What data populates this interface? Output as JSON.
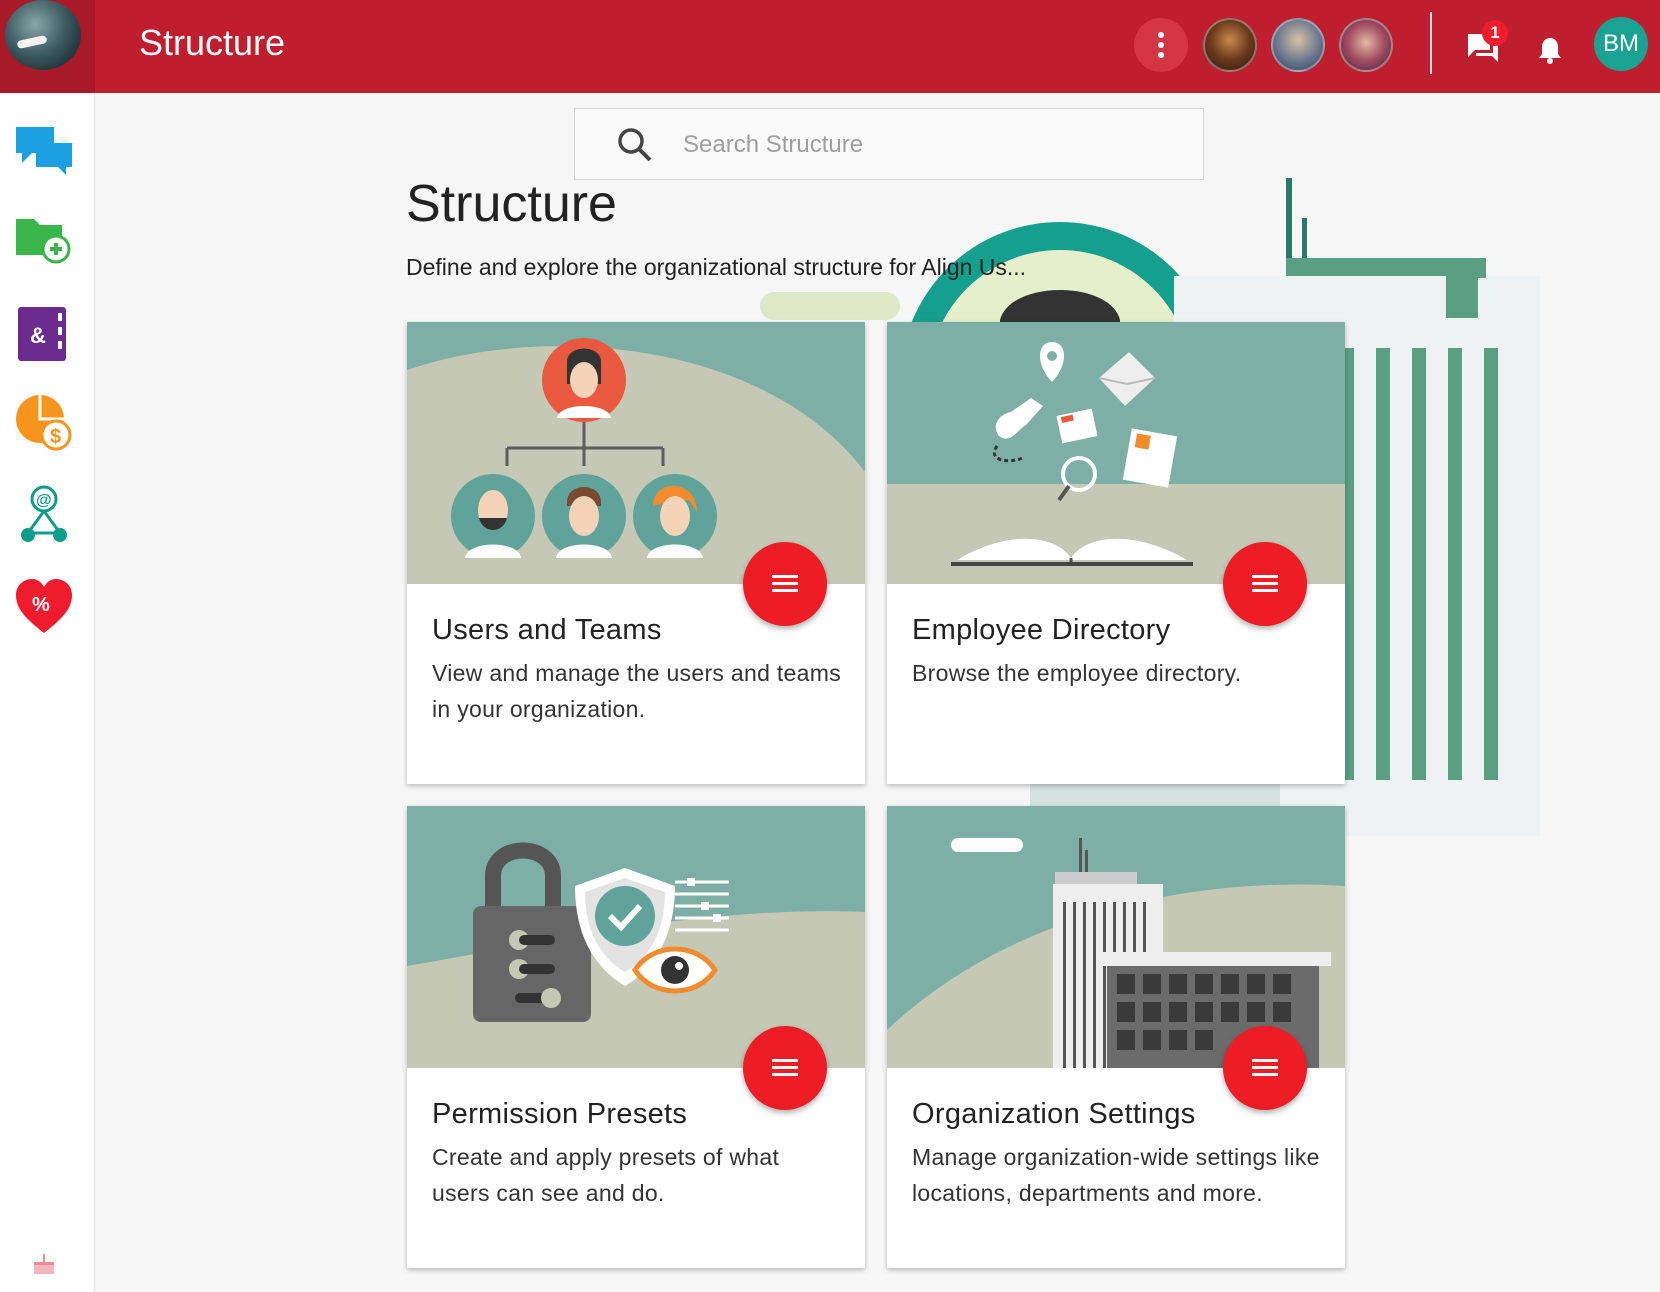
{
  "header": {
    "title": "Structure",
    "user_initials": "BM",
    "chat_badge_count": "1",
    "brand_color": "#be1e2d",
    "avatar_color": "#1aa392"
  },
  "sidebar": {
    "items": [
      {
        "icon": "chat-bubbles-icon",
        "color": "#1ba1e2"
      },
      {
        "icon": "folder-add-icon",
        "color": "#3ab54a"
      },
      {
        "icon": "directory-book-icon",
        "color": "#6c2c8f"
      },
      {
        "icon": "pie-dollar-icon",
        "color": "#f7941d"
      },
      {
        "icon": "org-network-icon",
        "color": "#0f9d8a"
      },
      {
        "icon": "heart-percent-icon",
        "color": "#ee1c2d"
      }
    ],
    "footer_icon": "birthday-cake-icon"
  },
  "search": {
    "placeholder": "Search Structure",
    "value": ""
  },
  "page": {
    "title": "Structure",
    "subtitle": "Define and explore the organizational structure for Align Us..."
  },
  "cards": [
    {
      "title": "Users and Teams",
      "description": "View and manage the users and teams in your organization."
    },
    {
      "title": "Employee Directory",
      "description": "Browse the employee directory."
    },
    {
      "title": "Permission Presets",
      "description": "Create and apply presets of what users can see and do."
    },
    {
      "title": "Organization Settings",
      "description": "Manage organization-wide settings like locations, departments and more."
    }
  ]
}
